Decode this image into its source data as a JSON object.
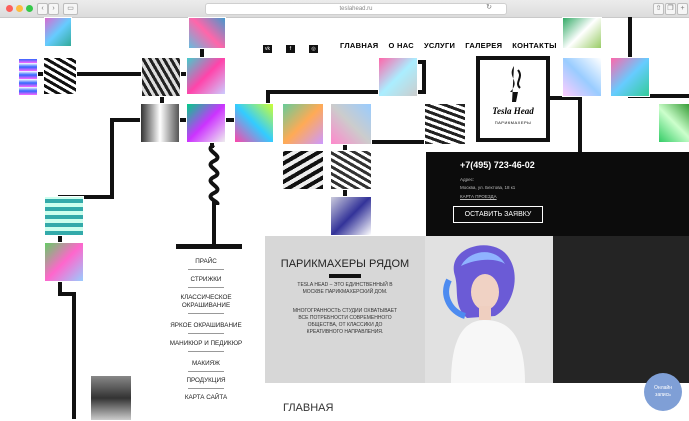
{
  "browser": {
    "url": "teslahead.ru"
  },
  "nav": {
    "items": [
      "ГЛАВНАЯ",
      "О НАС",
      "УСЛУГИ",
      "ГАЛЕРЕЯ",
      "КОНТАКТЫ"
    ]
  },
  "logo": {
    "line1": "Tesla",
    "line2": "Head",
    "sub": "ПАРИКМАХЕРЫ"
  },
  "contact": {
    "phone": "+7(495) 723-46-02",
    "address_label": "Адрес:",
    "address": "Москва, ул. Бехтова, 18 к1",
    "map_link": "КАРТА ПРОЕЗДА",
    "order_button": "ОСТАВИТЬ ЗАЯВКУ"
  },
  "side_menu": [
    "ПРАЙС",
    "СТРИЖКИ",
    "КЛАССИЧЕСКОЕ",
    "ОКРАШИВАНИЕ",
    "ЯРКОЕ ОКРАШИВАНИЕ",
    "МАНИКЮР И ПЕДИКЮР",
    "МАКИЯЖ",
    "ПРОДУКЦИЯ",
    "КАРТА САЙТА"
  ],
  "promo": {
    "title": "ПАРИКМАХЕРЫ РЯДОМ",
    "text1_l1": "TESLA HEAD – ЭТО ЕДИНСТВЕННЫЙ В",
    "text1_l2": "МОСКВЕ ПАРИКМАХЕРСКИЙ ДОМ.",
    "text2_l1": "МНОГОГРАННОСТЬ СТУДИИ ОХВАТЫВАЕТ",
    "text2_l2": "ВСЕ ПОТРЕБНОСТИ СОВРЕМЕННОГО",
    "text2_l3": "ОБЩЕСТВА, ОТ КЛАССИКИ ДО",
    "text2_l4": "КРЕАТИВНОГО НАПРАВЛЕНИЯ."
  },
  "footer_heading": "ГЛАВНАЯ",
  "chat": {
    "line1": "Онлайн",
    "line2": "запись"
  },
  "colors": {
    "accent_black": "#0c0c0c",
    "grey_panel": "#d7d7d7",
    "chat_blue": "#7f9fd6"
  }
}
